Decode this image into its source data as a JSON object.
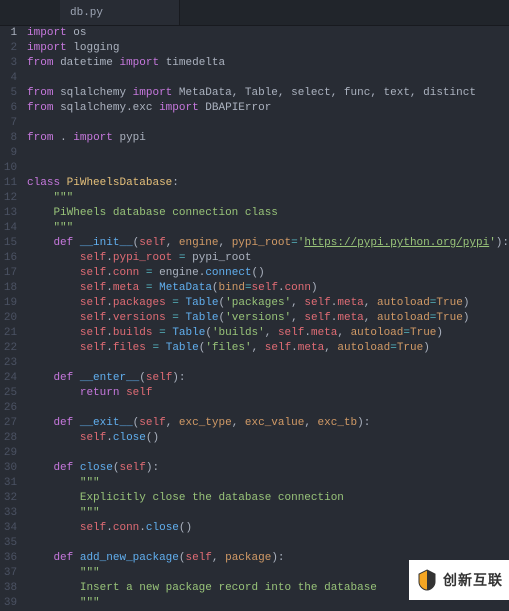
{
  "tab": {
    "filename": "db.py"
  },
  "lines": [
    {
      "n": "1",
      "tokens": [
        [
          "kw",
          "import "
        ],
        [
          "mod",
          "os"
        ]
      ]
    },
    {
      "n": "2",
      "tokens": [
        [
          "kw",
          "import "
        ],
        [
          "mod",
          "logging"
        ]
      ]
    },
    {
      "n": "3",
      "tokens": [
        [
          "kw",
          "from "
        ],
        [
          "mod",
          "datetime"
        ],
        [
          "kw",
          " import "
        ],
        [
          "mod",
          "timedelta"
        ]
      ]
    },
    {
      "n": "4",
      "tokens": []
    },
    {
      "n": "5",
      "tokens": [
        [
          "kw",
          "from "
        ],
        [
          "mod",
          "sqlalchemy"
        ],
        [
          "kw",
          " import "
        ],
        [
          "mod",
          "MetaData, Table, select, func, text, distinct"
        ]
      ]
    },
    {
      "n": "6",
      "tokens": [
        [
          "kw",
          "from "
        ],
        [
          "mod",
          "sqlalchemy.exc"
        ],
        [
          "kw",
          " import "
        ],
        [
          "mod",
          "DBAPIError"
        ]
      ]
    },
    {
      "n": "7",
      "tokens": []
    },
    {
      "n": "8",
      "tokens": [
        [
          "kw",
          "from "
        ],
        [
          "mod",
          "."
        ],
        [
          "kw",
          " import "
        ],
        [
          "mod",
          "pypi"
        ]
      ]
    },
    {
      "n": "9",
      "tokens": []
    },
    {
      "n": "10",
      "tokens": []
    },
    {
      "n": "11",
      "tokens": [
        [
          "kw",
          "class "
        ],
        [
          "cls",
          "PiWheelsDatabase"
        ],
        [
          "punc",
          ":"
        ]
      ]
    },
    {
      "n": "12",
      "tokens": [
        [
          "",
          "    "
        ],
        [
          "t",
          "\"\"\""
        ]
      ]
    },
    {
      "n": "13",
      "tokens": [
        [
          "",
          "    "
        ],
        [
          "docs",
          "PiWheels database connection class"
        ]
      ]
    },
    {
      "n": "14",
      "tokens": [
        [
          "",
          "    "
        ],
        [
          "t",
          "\"\"\""
        ]
      ]
    },
    {
      "n": "15",
      "tokens": [
        [
          "",
          "    "
        ],
        [
          "kw",
          "def "
        ],
        [
          "fn",
          "__init__"
        ],
        [
          "punc",
          "("
        ],
        [
          "self",
          "self"
        ],
        [
          "punc",
          ", "
        ],
        [
          "param",
          "engine"
        ],
        [
          "punc",
          ", "
        ],
        [
          "param",
          "pypi_root"
        ],
        [
          "op",
          "="
        ],
        [
          "str",
          "'"
        ],
        [
          "strul",
          "https://pypi.python.org/pypi"
        ],
        [
          "str",
          "'"
        ],
        [
          "punc",
          "):"
        ]
      ]
    },
    {
      "n": "16",
      "tokens": [
        [
          "",
          "        "
        ],
        [
          "self",
          "self"
        ],
        [
          "punc",
          "."
        ],
        [
          "attr",
          "pypi_root"
        ],
        [
          "punc",
          " "
        ],
        [
          "op",
          "="
        ],
        [
          "punc",
          " pypi_root"
        ]
      ]
    },
    {
      "n": "17",
      "tokens": [
        [
          "",
          "        "
        ],
        [
          "self",
          "self"
        ],
        [
          "punc",
          "."
        ],
        [
          "attr",
          "conn"
        ],
        [
          "punc",
          " "
        ],
        [
          "op",
          "="
        ],
        [
          "punc",
          " engine."
        ],
        [
          "fn",
          "connect"
        ],
        [
          "punc",
          "()"
        ]
      ]
    },
    {
      "n": "18",
      "tokens": [
        [
          "",
          "        "
        ],
        [
          "self",
          "self"
        ],
        [
          "punc",
          "."
        ],
        [
          "attr",
          "meta"
        ],
        [
          "punc",
          " "
        ],
        [
          "op",
          "="
        ],
        [
          "punc",
          " "
        ],
        [
          "fn",
          "MetaData"
        ],
        [
          "punc",
          "("
        ],
        [
          "kwarg",
          "bind"
        ],
        [
          "op",
          "="
        ],
        [
          "self",
          "self"
        ],
        [
          "punc",
          "."
        ],
        [
          "attr",
          "conn"
        ],
        [
          "punc",
          ")"
        ]
      ]
    },
    {
      "n": "19",
      "tokens": [
        [
          "",
          "        "
        ],
        [
          "self",
          "self"
        ],
        [
          "punc",
          "."
        ],
        [
          "attr",
          "packages"
        ],
        [
          "punc",
          " "
        ],
        [
          "op",
          "="
        ],
        [
          "punc",
          " "
        ],
        [
          "fn",
          "Table"
        ],
        [
          "punc",
          "("
        ],
        [
          "str",
          "'packages'"
        ],
        [
          "punc",
          ", "
        ],
        [
          "self",
          "self"
        ],
        [
          "punc",
          "."
        ],
        [
          "attr",
          "meta"
        ],
        [
          "punc",
          ", "
        ],
        [
          "kwarg",
          "autoload"
        ],
        [
          "op",
          "="
        ],
        [
          "const",
          "True"
        ],
        [
          "punc",
          ")"
        ]
      ]
    },
    {
      "n": "20",
      "tokens": [
        [
          "",
          "        "
        ],
        [
          "self",
          "self"
        ],
        [
          "punc",
          "."
        ],
        [
          "attr",
          "versions"
        ],
        [
          "punc",
          " "
        ],
        [
          "op",
          "="
        ],
        [
          "punc",
          " "
        ],
        [
          "fn",
          "Table"
        ],
        [
          "punc",
          "("
        ],
        [
          "str",
          "'versions'"
        ],
        [
          "punc",
          ", "
        ],
        [
          "self",
          "self"
        ],
        [
          "punc",
          "."
        ],
        [
          "attr",
          "meta"
        ],
        [
          "punc",
          ", "
        ],
        [
          "kwarg",
          "autoload"
        ],
        [
          "op",
          "="
        ],
        [
          "const",
          "True"
        ],
        [
          "punc",
          ")"
        ]
      ]
    },
    {
      "n": "21",
      "tokens": [
        [
          "",
          "        "
        ],
        [
          "self",
          "self"
        ],
        [
          "punc",
          "."
        ],
        [
          "attr",
          "builds"
        ],
        [
          "punc",
          " "
        ],
        [
          "op",
          "="
        ],
        [
          "punc",
          " "
        ],
        [
          "fn",
          "Table"
        ],
        [
          "punc",
          "("
        ],
        [
          "str",
          "'builds'"
        ],
        [
          "punc",
          ", "
        ],
        [
          "self",
          "self"
        ],
        [
          "punc",
          "."
        ],
        [
          "attr",
          "meta"
        ],
        [
          "punc",
          ", "
        ],
        [
          "kwarg",
          "autoload"
        ],
        [
          "op",
          "="
        ],
        [
          "const",
          "True"
        ],
        [
          "punc",
          ")"
        ]
      ]
    },
    {
      "n": "22",
      "tokens": [
        [
          "",
          "        "
        ],
        [
          "self",
          "self"
        ],
        [
          "punc",
          "."
        ],
        [
          "attr",
          "files"
        ],
        [
          "punc",
          " "
        ],
        [
          "op",
          "="
        ],
        [
          "punc",
          " "
        ],
        [
          "fn",
          "Table"
        ],
        [
          "punc",
          "("
        ],
        [
          "str",
          "'files'"
        ],
        [
          "punc",
          ", "
        ],
        [
          "self",
          "self"
        ],
        [
          "punc",
          "."
        ],
        [
          "attr",
          "meta"
        ],
        [
          "punc",
          ", "
        ],
        [
          "kwarg",
          "autoload"
        ],
        [
          "op",
          "="
        ],
        [
          "const",
          "True"
        ],
        [
          "punc",
          ")"
        ]
      ]
    },
    {
      "n": "23",
      "tokens": []
    },
    {
      "n": "24",
      "tokens": [
        [
          "",
          "    "
        ],
        [
          "kw",
          "def "
        ],
        [
          "fn",
          "__enter__"
        ],
        [
          "punc",
          "("
        ],
        [
          "self",
          "self"
        ],
        [
          "punc",
          "):"
        ]
      ]
    },
    {
      "n": "25",
      "tokens": [
        [
          "",
          "        "
        ],
        [
          "kw",
          "return "
        ],
        [
          "self",
          "self"
        ]
      ]
    },
    {
      "n": "26",
      "tokens": []
    },
    {
      "n": "27",
      "tokens": [
        [
          "",
          "    "
        ],
        [
          "kw",
          "def "
        ],
        [
          "fn",
          "__exit__"
        ],
        [
          "punc",
          "("
        ],
        [
          "self",
          "self"
        ],
        [
          "punc",
          ", "
        ],
        [
          "param",
          "exc_type"
        ],
        [
          "punc",
          ", "
        ],
        [
          "param",
          "exc_value"
        ],
        [
          "punc",
          ", "
        ],
        [
          "param",
          "exc_tb"
        ],
        [
          "punc",
          "):"
        ]
      ]
    },
    {
      "n": "28",
      "tokens": [
        [
          "",
          "        "
        ],
        [
          "self",
          "self"
        ],
        [
          "punc",
          "."
        ],
        [
          "fn",
          "close"
        ],
        [
          "punc",
          "()"
        ]
      ]
    },
    {
      "n": "29",
      "tokens": []
    },
    {
      "n": "30",
      "tokens": [
        [
          "",
          "    "
        ],
        [
          "kw",
          "def "
        ],
        [
          "fn",
          "close"
        ],
        [
          "punc",
          "("
        ],
        [
          "self",
          "self"
        ],
        [
          "punc",
          "):"
        ]
      ]
    },
    {
      "n": "31",
      "tokens": [
        [
          "",
          "        "
        ],
        [
          "t",
          "\"\"\""
        ]
      ]
    },
    {
      "n": "32",
      "tokens": [
        [
          "",
          "        "
        ],
        [
          "docs",
          "Explicitly close the database connection"
        ]
      ]
    },
    {
      "n": "33",
      "tokens": [
        [
          "",
          "        "
        ],
        [
          "t",
          "\"\"\""
        ]
      ]
    },
    {
      "n": "34",
      "tokens": [
        [
          "",
          "        "
        ],
        [
          "self",
          "self"
        ],
        [
          "punc",
          "."
        ],
        [
          "attr",
          "conn"
        ],
        [
          "punc",
          "."
        ],
        [
          "fn",
          "close"
        ],
        [
          "punc",
          "()"
        ]
      ]
    },
    {
      "n": "35",
      "tokens": []
    },
    {
      "n": "36",
      "tokens": [
        [
          "",
          "    "
        ],
        [
          "kw",
          "def "
        ],
        [
          "fn",
          "add_new_package"
        ],
        [
          "punc",
          "("
        ],
        [
          "self",
          "self"
        ],
        [
          "punc",
          ", "
        ],
        [
          "param",
          "package"
        ],
        [
          "punc",
          "):"
        ]
      ]
    },
    {
      "n": "37",
      "tokens": [
        [
          "",
          "        "
        ],
        [
          "t",
          "\"\"\""
        ]
      ]
    },
    {
      "n": "38",
      "tokens": [
        [
          "",
          "        "
        ],
        [
          "docs",
          "Insert a new package record into the database"
        ]
      ]
    },
    {
      "n": "39",
      "tokens": [
        [
          "",
          "        "
        ],
        [
          "t",
          "\"\"\""
        ]
      ]
    }
  ],
  "active_line": "1",
  "logo_text": "创新互联"
}
